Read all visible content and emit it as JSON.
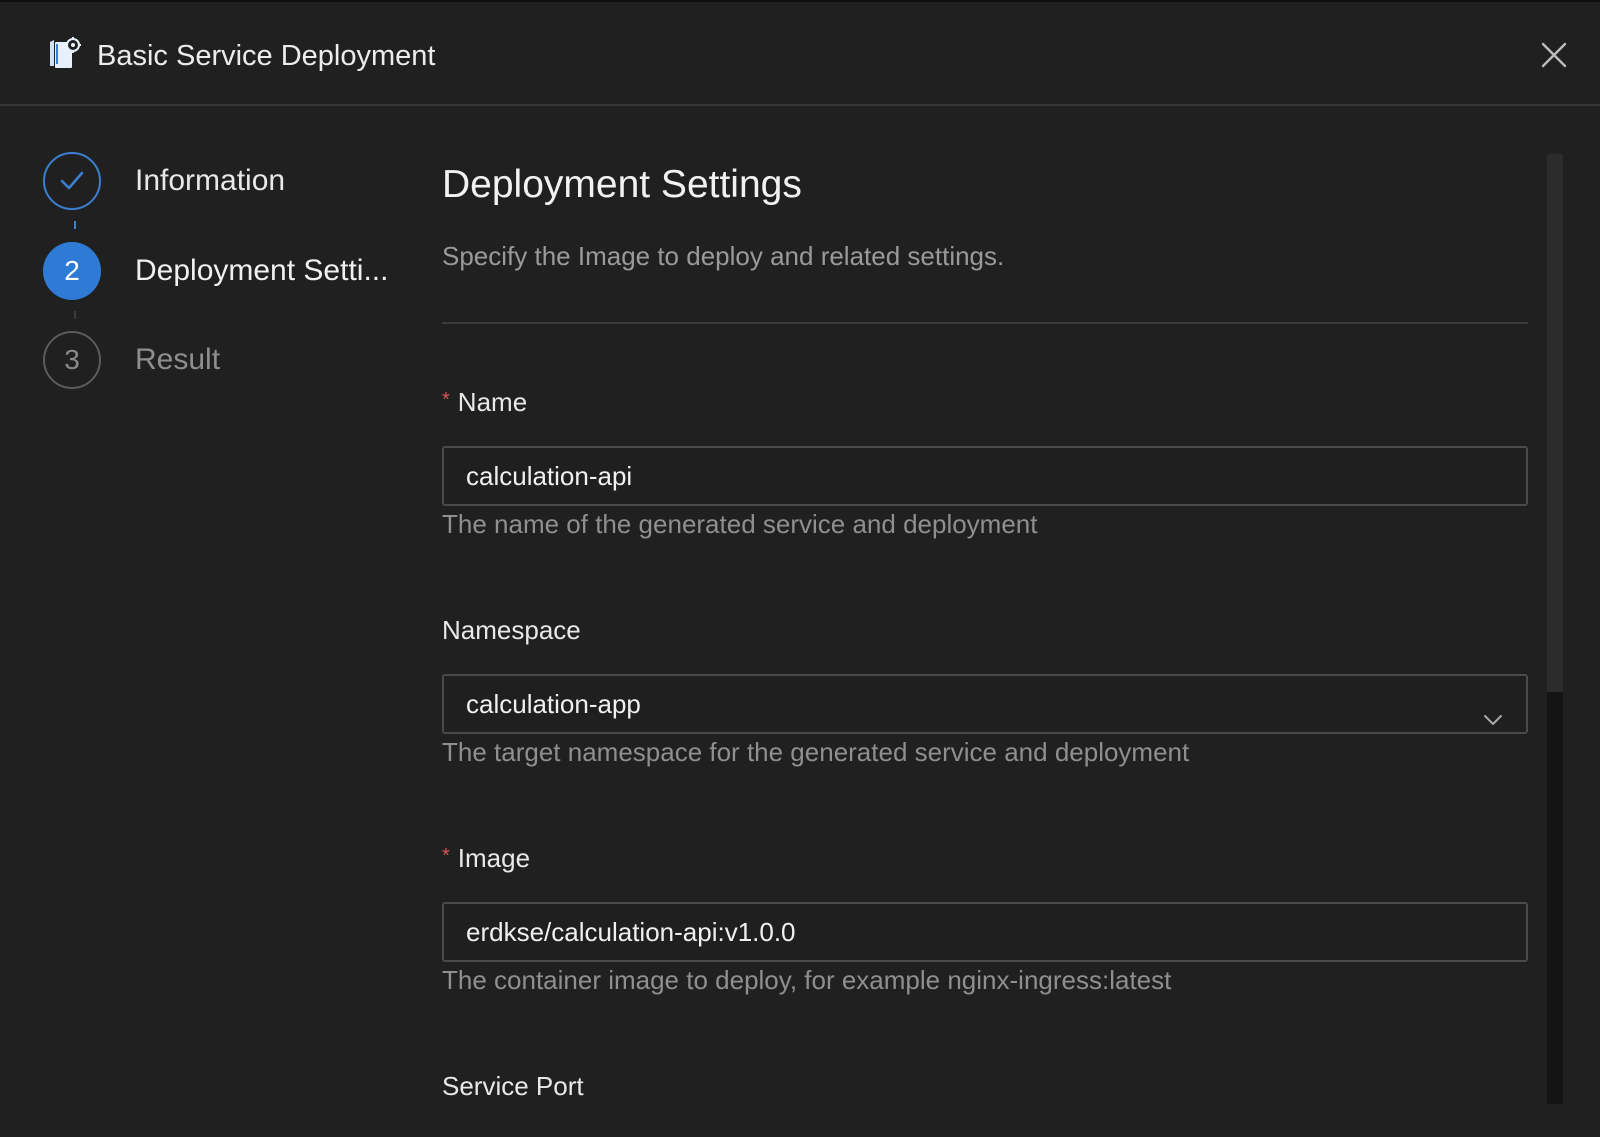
{
  "dialog": {
    "title": "Basic Service Deployment",
    "icon": "deployment-gear-icon",
    "close_icon": "close-icon"
  },
  "steps": [
    {
      "number": "1",
      "label": "Information",
      "state": "done"
    },
    {
      "number": "2",
      "label": "Deployment Setti...",
      "state": "active"
    },
    {
      "number": "3",
      "label": "Result",
      "state": "pending"
    }
  ],
  "main": {
    "title": "Deployment Settings",
    "description": "Specify the Image to deploy and related settings.",
    "fields": {
      "name": {
        "label": "Name",
        "required": true,
        "value": "calculation-api",
        "help": "The name of the generated service and deployment"
      },
      "namespace": {
        "label": "Namespace",
        "required": false,
        "value": "calculation-app",
        "help": "The target namespace for the generated service and deployment"
      },
      "image": {
        "label": "Image",
        "required": true,
        "value": "erdkse/calculation-api:v1.0.0",
        "help": "The container image to deploy, for example nginx-ingress:latest"
      },
      "service_port": {
        "label": "Service Port"
      }
    },
    "required_marker": "*"
  },
  "colors": {
    "background": "#202020",
    "accent": "#2e7bd6",
    "required": "#d9534f"
  }
}
